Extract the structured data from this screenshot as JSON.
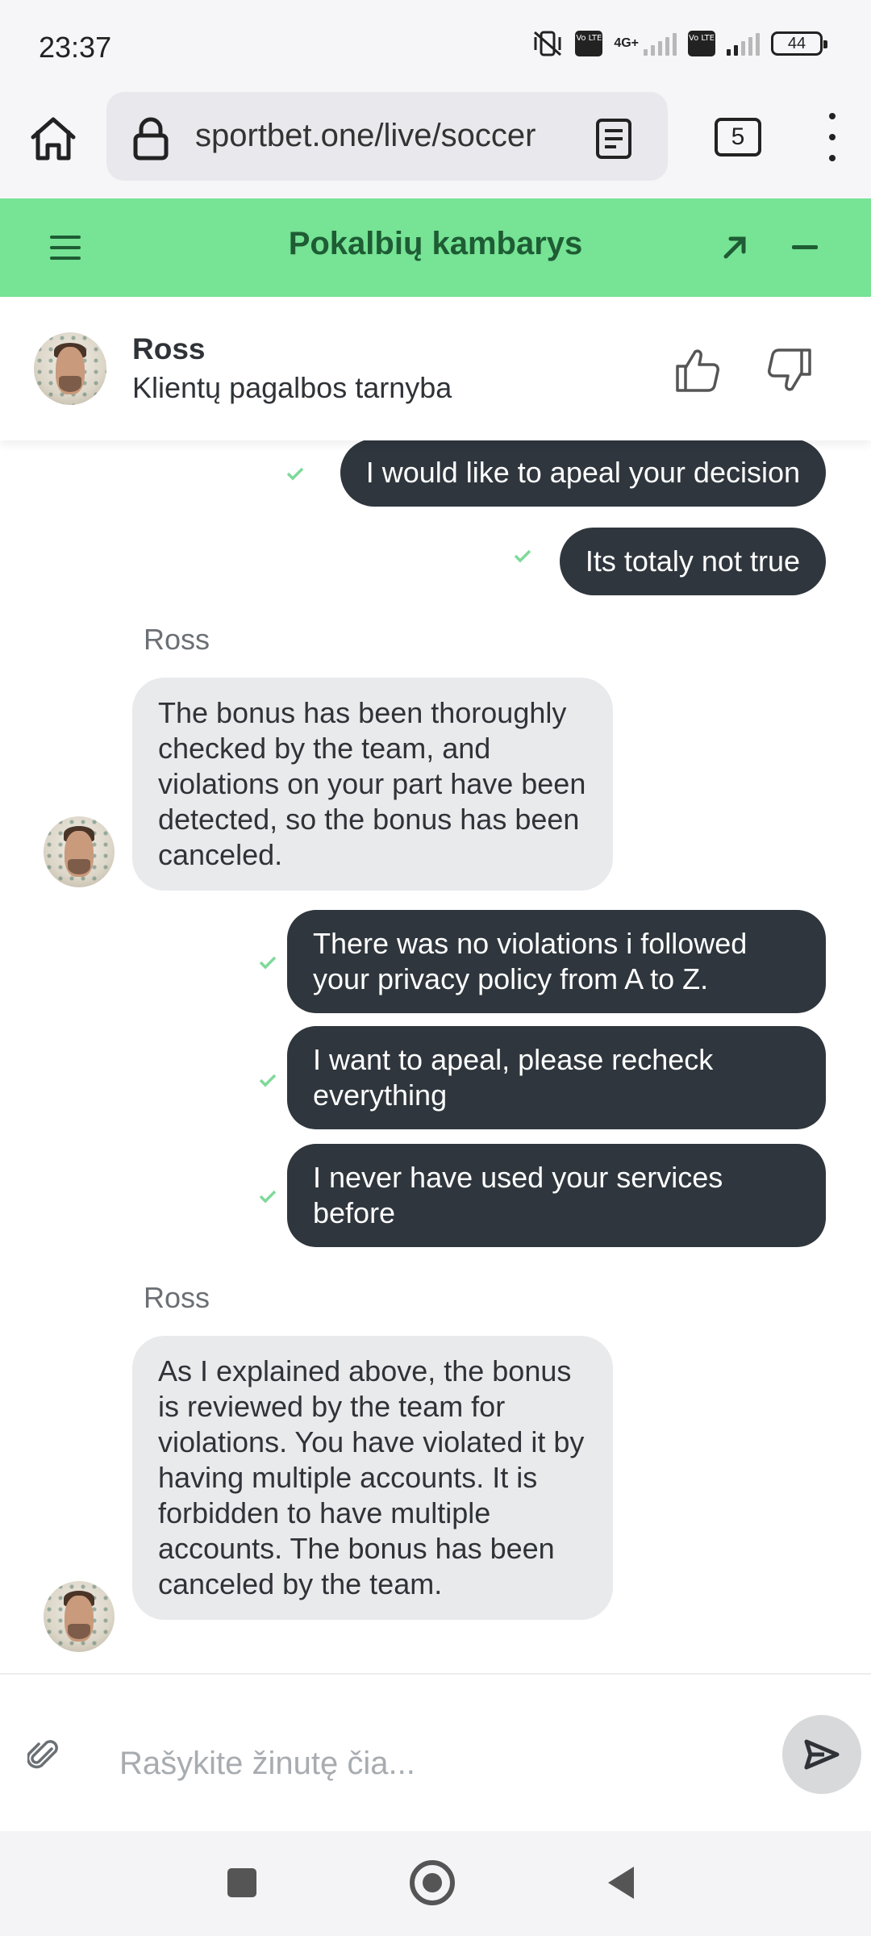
{
  "status": {
    "time": "23:37",
    "battery": "44",
    "net_label": "4G+",
    "volte_label": "Vo LTE"
  },
  "browser": {
    "url": "sportbet.one/live/soccer",
    "tab_count": "5"
  },
  "header": {
    "title": "Pokalbių kambarys"
  },
  "agent": {
    "name": "Ross",
    "role": "Klientų pagalbos tarnyba"
  },
  "messages": [
    {
      "dir": "out",
      "text": "I would like to apeal your decision"
    },
    {
      "dir": "out",
      "text": "Its totaly not true"
    },
    {
      "dir": "in",
      "sender": "Ross",
      "text": "The bonus has been thoroughly checked by the team, and violations on your part have been detected, so the bonus has been canceled."
    },
    {
      "dir": "out",
      "text": "There was no violations i followed your privacy policy from A to Z."
    },
    {
      "dir": "out",
      "text": "I want to apeal, please recheck everything"
    },
    {
      "dir": "out",
      "text": "I never have used your services before"
    },
    {
      "dir": "in",
      "sender": "Ross",
      "text": "As I explained above, the bonus is reviewed by the team for violations. You have violated it by having multiple accounts. It is forbidden to have multiple accounts. The bonus has been canceled by the team."
    }
  ],
  "composer": {
    "placeholder": "Rašykite žinutę čia..."
  },
  "colors": {
    "header_green": "#76e395",
    "header_text": "#1e5c34",
    "out_bubble": "#2f363d",
    "in_bubble": "#e9eaec",
    "check_green": "#7fd99a"
  }
}
